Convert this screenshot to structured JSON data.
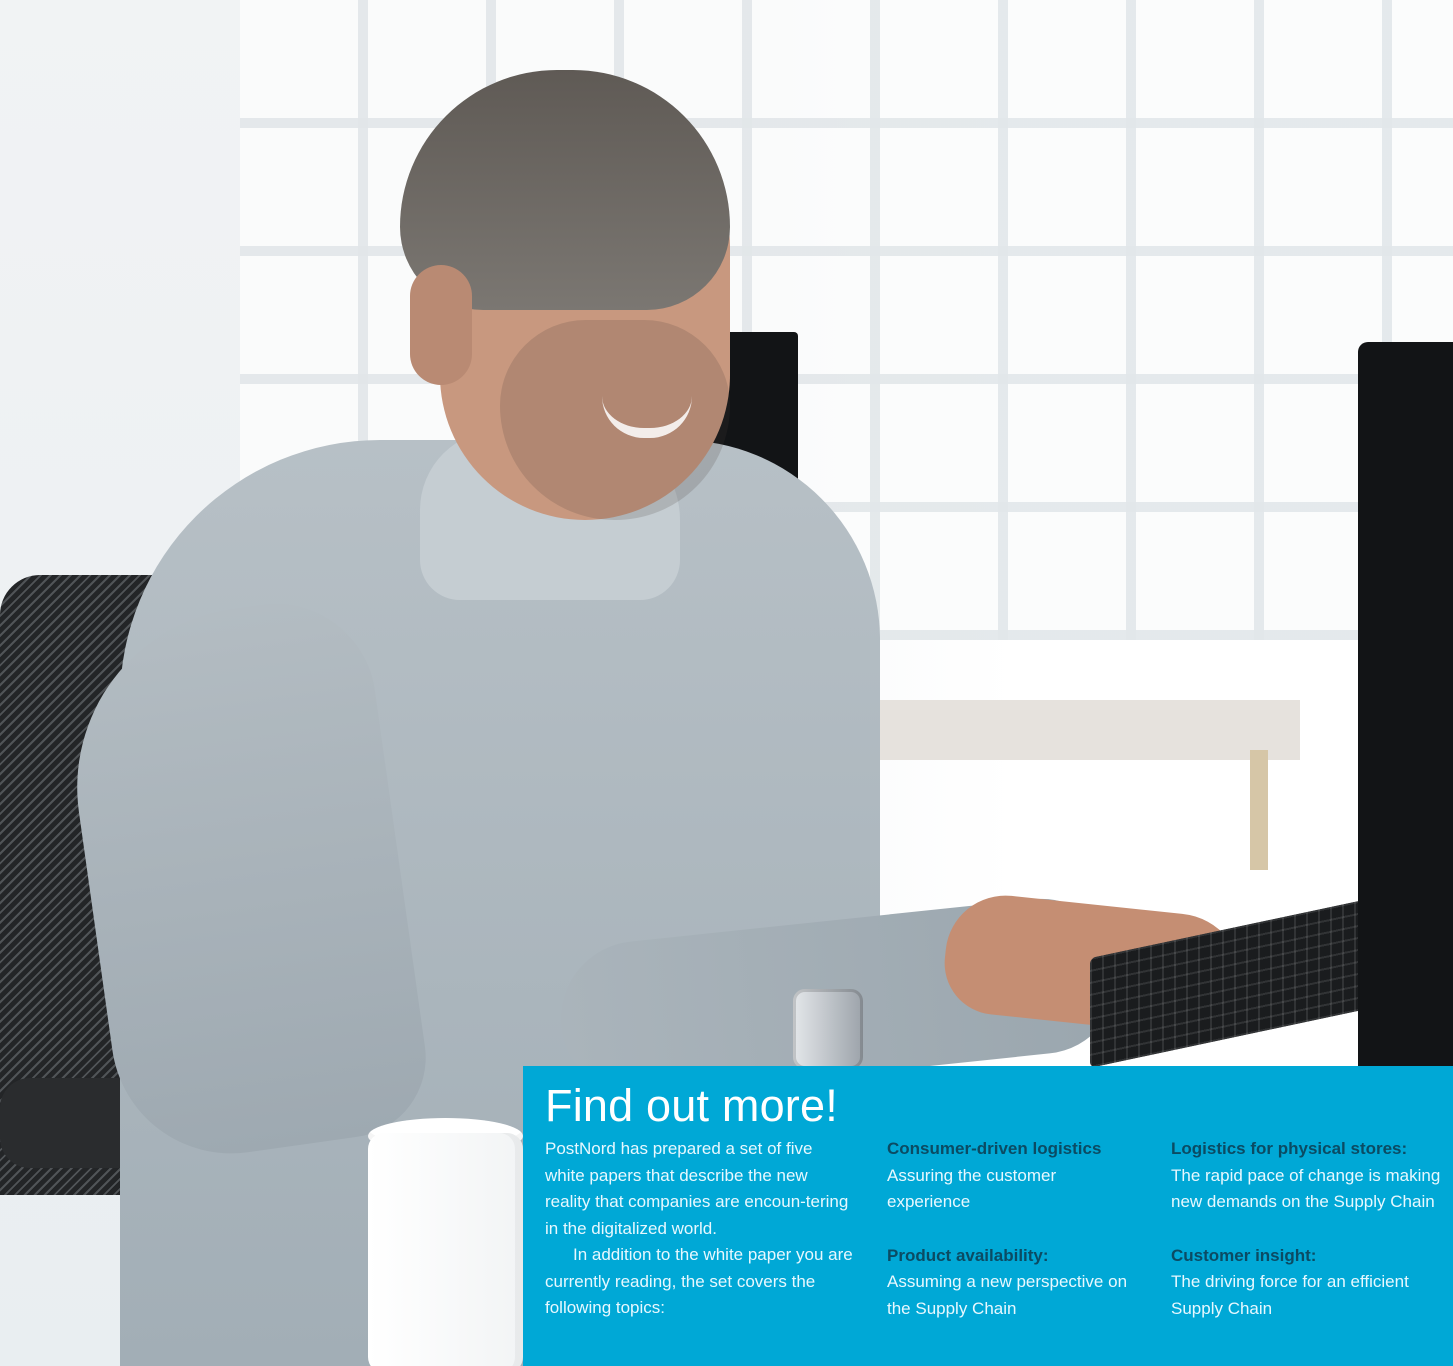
{
  "panel": {
    "title": "Find out more!",
    "intro_p1": "PostNord has prepared a set of five white papers that describe the new reality that companies are encoun-tering in the digitalized world.",
    "intro_p2": "In addition to the white paper you are currently reading, the set covers the following topics:",
    "topics": [
      {
        "heading": "Consumer-driven logistics",
        "text": "Assuring the customer experience"
      },
      {
        "heading": "Product availability:",
        "text": "Assuming a new perspective on the Supply Chain"
      },
      {
        "heading": "Logistics for physical stores:",
        "text": "The rapid pace of change is making new demands on the Supply Chain"
      },
      {
        "heading": "Customer insight:",
        "text": "The driving force for an efficient Supply Chain"
      }
    ],
    "colors": {
      "background": "#00a8d6",
      "text": "#e7f8ff",
      "heading": "#0b4b63"
    }
  }
}
